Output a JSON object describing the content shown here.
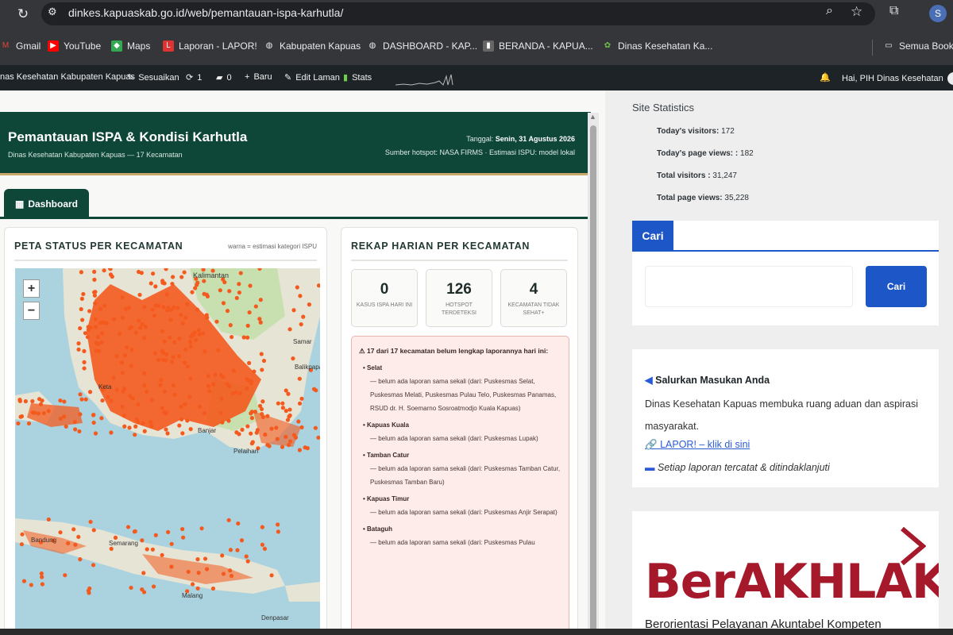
{
  "browser": {
    "url": "dinkes.kapuaskab.go.id/web/pemantauan-ispa-karhutla/",
    "profile_initial": "S",
    "bookmarks": [
      "Gmail",
      "YouTube",
      "Maps",
      "Laporan - LAPOR!",
      "Kabupaten Kapuas",
      "DASHBOARD - KAP...",
      "BERANDA - KAPUA...",
      "Dinas Kesehatan Ka...",
      "Semua Bookm"
    ]
  },
  "adminbar": {
    "site": "nas Kesehatan Kabupaten Kapuas",
    "customize": "Sesuaikan",
    "updates": "1",
    "comments": "0",
    "new": "Baru",
    "edit": "Edit Laman",
    "stats": "Stats",
    "greeting": "Hai, PIH Dinas Kesehatan"
  },
  "page": {
    "title": "Pemantauan ISPA & Kondisi Karhutla",
    "subtitle": "Dinas Kesehatan Kabupaten Kapuas — 17 Kecamatan",
    "date_label": "Tanggal:",
    "date_value": "Senin, 31 Agustus 2026",
    "source": "Sumber hotspot: NASA FIRMS · Estimasi ISPU: model lokal",
    "tab": "Dashboard"
  },
  "map_card": {
    "heading": "PETA STATUS PER KECAMATAN",
    "note": "warna = estimasi kategori ISPU",
    "zoom_in": "+",
    "zoom_out": "−",
    "labels": {
      "kalimantan": "Kalimantan",
      "samarinda": "Samar",
      "balikpapan": "Balikpapa",
      "banjar": "Banjar",
      "pelaihari": "Pelaihari",
      "ketapang": "Keta",
      "bandung": "Bandung",
      "semarang": "Semarang",
      "malang": "Malang",
      "denpasar": "Denpasar"
    }
  },
  "rekap": {
    "heading": "REKAP HARIAN PER KECAMATAN",
    "tiles": [
      {
        "value": "0",
        "label": "KASUS ISPA HARI INI"
      },
      {
        "value": "126",
        "label": "HOTSPOT TERDETEKSI"
      },
      {
        "value": "4",
        "label": "KECAMATAN TIDAK SEHAT+"
      }
    ],
    "warning_title": "⚠ 17 dari 17 kecamatan belum lengkap laporannya hari ini:",
    "items": [
      {
        "name": "Selat",
        "detail": "— belum ada laporan sama sekali (dari: Puskesmas Selat, Puskesmas Melati, Puskesmas Pulau Telo, Puskesmas Panamas, RSUD dr. H. Soemarno Sosroatmodjo Kuala Kapuas)"
      },
      {
        "name": "Kapuas Kuala",
        "detail": "— belum ada laporan sama sekali (dari: Puskesmas Lupak)"
      },
      {
        "name": "Tamban Catur",
        "detail": "— belum ada laporan sama sekali (dari: Puskesmas Tamban Catur, Puskesmas Tamban Baru)"
      },
      {
        "name": "Kapuas Timur",
        "detail": "— belum ada laporan sama sekali (dari: Puskesmas Anjir Serapat)"
      },
      {
        "name": "Bataguh",
        "detail": "— belum ada laporan sama sekali (dari: Puskesmas Pulau"
      }
    ]
  },
  "sidebar": {
    "stats_heading": "Site Statistics",
    "stats": [
      {
        "label": "Today's visitors:",
        "value": "172"
      },
      {
        "label": "Today's page views: :",
        "value": "182"
      },
      {
        "label": "Total visitors :",
        "value": "31,247"
      },
      {
        "label": "Total page views:",
        "value": "35,228"
      }
    ],
    "search_tab": "Cari",
    "search_button": "Cari",
    "aduan_title": "Salurkan Masukan Anda",
    "aduan_text": "Dinas Kesehatan Kapuas membuka ruang aduan dan aspirasi masyarakat.",
    "aduan_link": "LAPOR! – klik di sini",
    "aduan_note": "Setiap laporan tercatat & ditindaklanjuti",
    "logo_text": "BerAKHLAK",
    "logo_tagline": "Berorientasi Pelayanan Akuntabel Kompeten"
  },
  "colors": {
    "header": "#0e4638",
    "accent": "#1d56c7",
    "hotspot": "#f45a1e",
    "logo": "#a5192b"
  }
}
